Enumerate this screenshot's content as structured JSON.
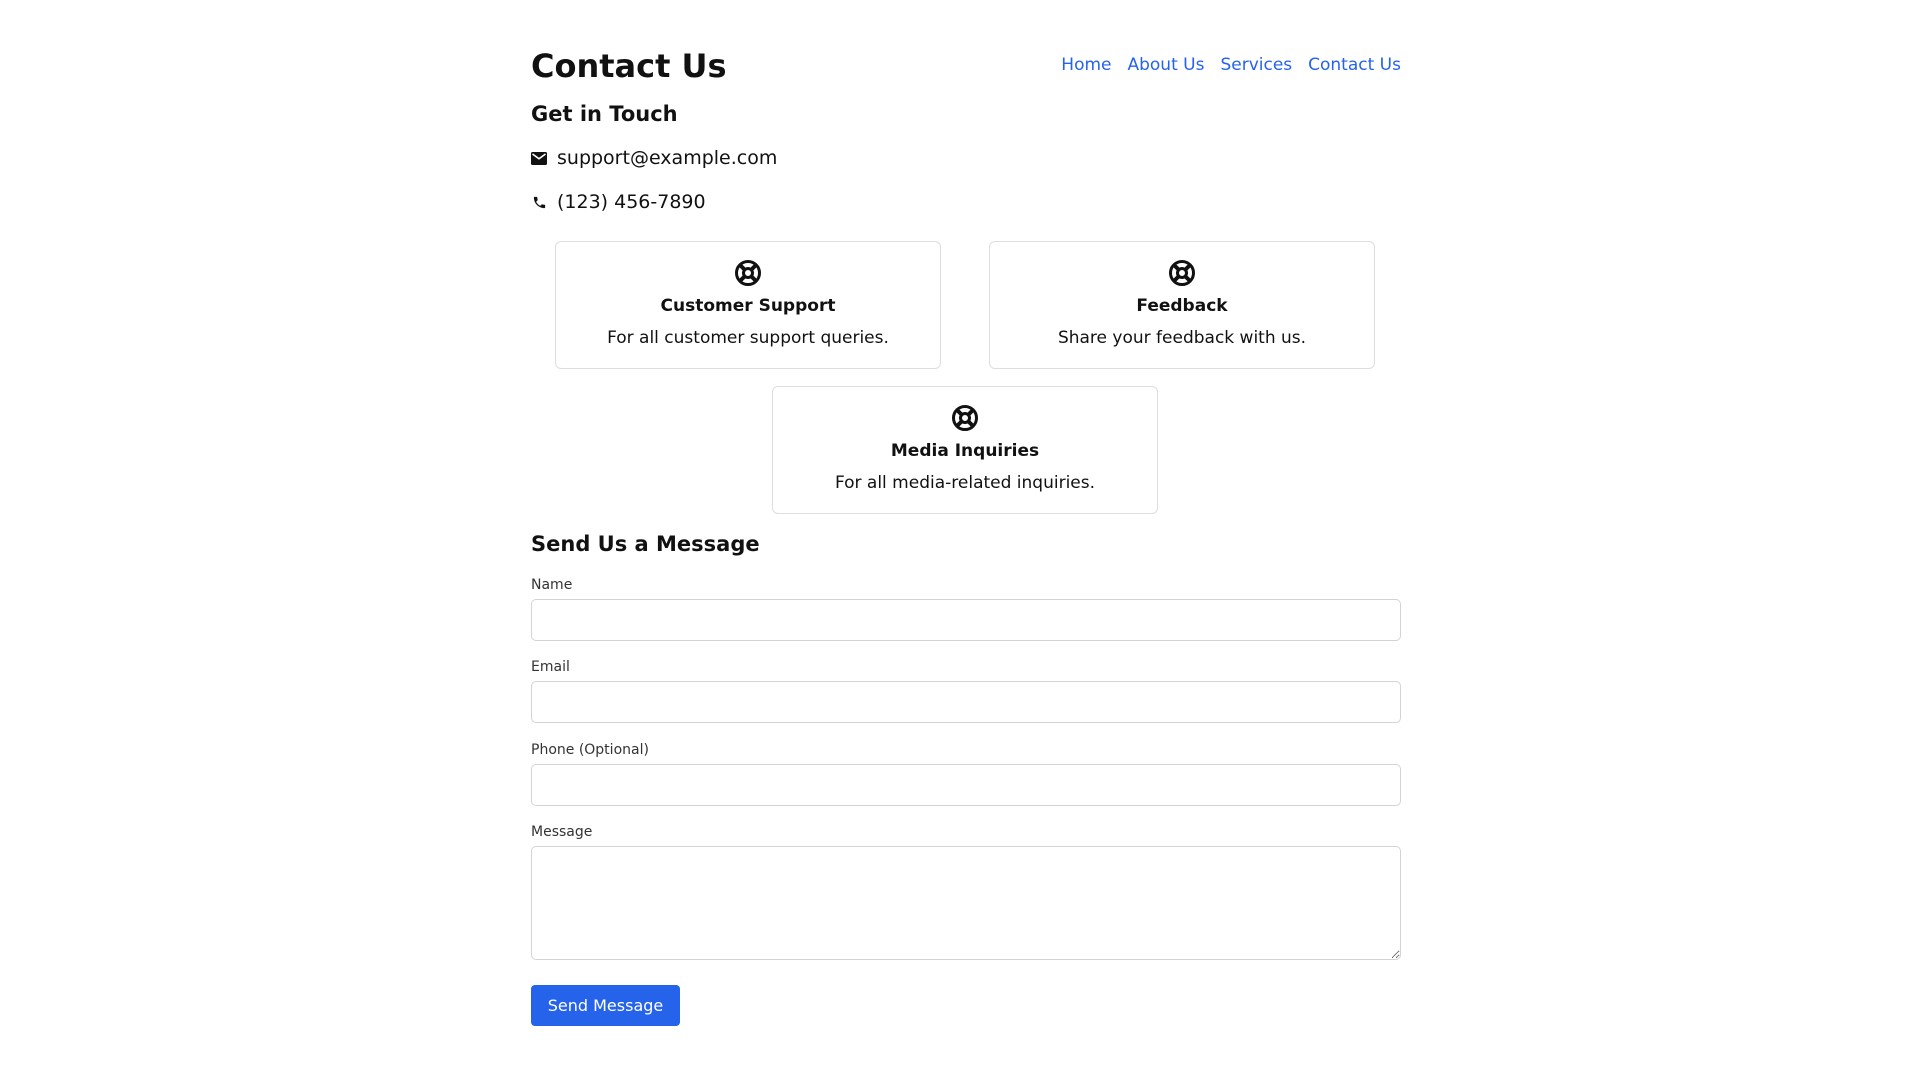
{
  "header": {
    "title": "Contact Us",
    "nav": [
      "Home",
      "About Us",
      "Services",
      "Contact Us"
    ]
  },
  "get_in_touch": {
    "title": "Get in Touch",
    "email": "support@example.com",
    "email_icon": "envelope-icon",
    "phone": "(123) 456-7890",
    "phone_icon": "phone-icon"
  },
  "cards": [
    {
      "icon": "lifebuoy-icon",
      "title": "Customer Support",
      "description": "For all customer support queries."
    },
    {
      "icon": "lifebuoy-icon",
      "title": "Feedback",
      "description": "Share your feedback with us."
    },
    {
      "icon": "lifebuoy-icon",
      "title": "Media Inquiries",
      "description": "For all media-related inquiries."
    }
  ],
  "form": {
    "title": "Send Us a Message",
    "name_label": "Name",
    "name_value": "",
    "email_label": "Email",
    "email_value": "",
    "phone_label": "Phone (Optional)",
    "phone_value": "",
    "message_label": "Message",
    "message_value": "",
    "submit_label": "Send Message"
  },
  "colors": {
    "accent": "#2563eb",
    "text": "#111111",
    "border": "#d4d4d4",
    "background": "#ffffff"
  }
}
